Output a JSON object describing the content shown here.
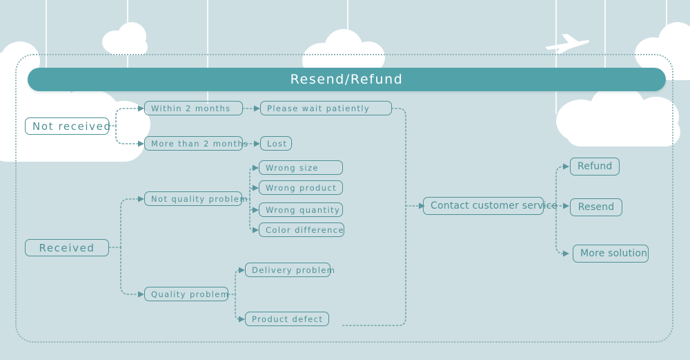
{
  "theme": {
    "background": "#cddfe3",
    "banner_fill": "#52a2aa",
    "banner_text": "#ffffff",
    "node_border": "#4e9096",
    "node_text": "#4e9096",
    "connector": "#6fa3a9",
    "frame_border": "#8fb4b9",
    "cloud": "#ffffff"
  },
  "banner": {
    "title": "Resend/Refund"
  },
  "flowchart": {
    "type": "flow-diagram",
    "roots": [
      {
        "id": "not-received",
        "label": "Not received"
      },
      {
        "id": "received",
        "label": "Received"
      }
    ],
    "branches": {
      "not_received": [
        {
          "id": "within-2-months",
          "label": "Within 2 months",
          "result": {
            "id": "please-wait-patiently",
            "label": "Please wait patiently"
          }
        },
        {
          "id": "more-than-2-months",
          "label": "More than 2 months",
          "result": {
            "id": "lost",
            "label": "Lost"
          }
        }
      ],
      "received": [
        {
          "id": "not-quality-problem",
          "label": "Not quality problem",
          "children": [
            {
              "id": "wrong-size",
              "label": "Wrong size"
            },
            {
              "id": "wrong-product",
              "label": "Wrong product"
            },
            {
              "id": "wrong-quantity",
              "label": "Wrong quantity"
            },
            {
              "id": "color-difference",
              "label": "Color difference"
            }
          ]
        },
        {
          "id": "quality-problem",
          "label": "Quality problem",
          "children": [
            {
              "id": "delivery-problem",
              "label": "Delivery problem"
            },
            {
              "id": "product-defect",
              "label": "Product defect"
            }
          ]
        }
      ]
    },
    "hub": {
      "id": "contact-customer-service",
      "label": "Contact customer service"
    },
    "solutions": [
      {
        "id": "refund",
        "label": "Refund"
      },
      {
        "id": "resend",
        "label": "Resend"
      },
      {
        "id": "more-solution",
        "label": "More solution"
      }
    ]
  },
  "decorations": {
    "plane_icon": "airplane-icon",
    "clouds_label": "cloud-decoration",
    "strings_label": "hanging-string"
  }
}
